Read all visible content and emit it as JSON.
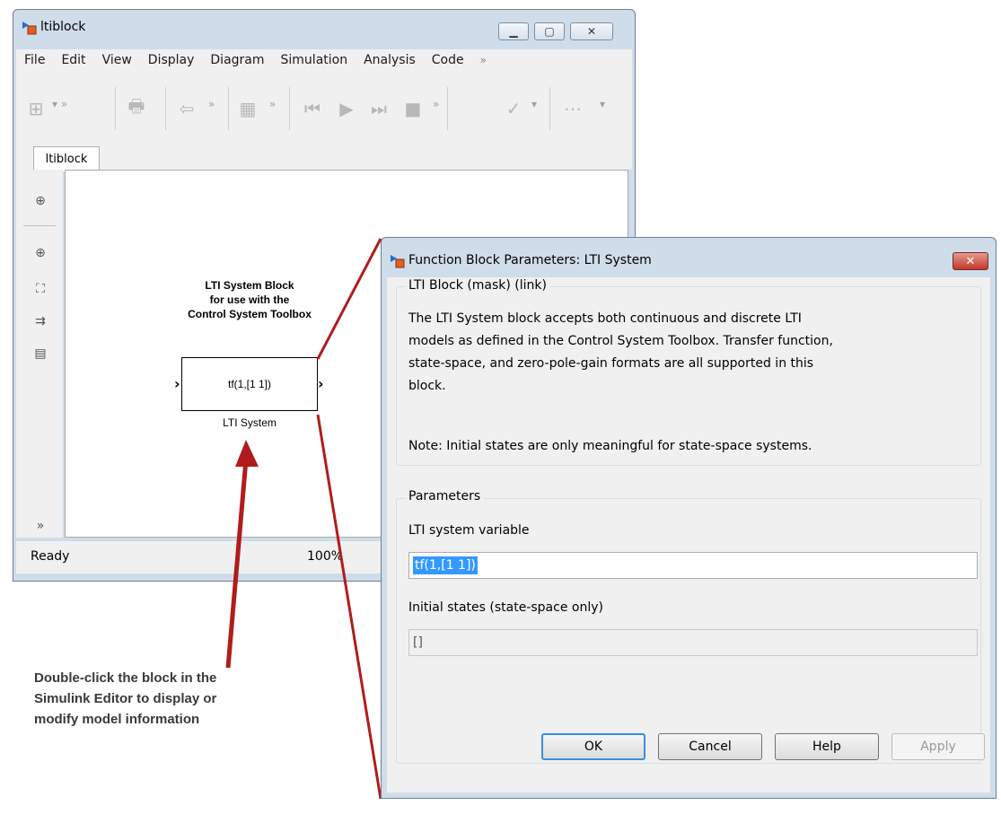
{
  "editor": {
    "title": "ltiblock",
    "menu": [
      "File",
      "Edit",
      "View",
      "Display",
      "Diagram",
      "Simulation",
      "Analysis",
      "Code"
    ],
    "menu_more": "»",
    "tab_label": "ltiblock",
    "status_left": "Ready",
    "zoom": "100%"
  },
  "block": {
    "caption_line1": "LTI System Block",
    "caption_line2": "for use with the",
    "caption_line3": "Control System Toolbox",
    "expression": "tf(1,[1 1])",
    "name": "LTI System"
  },
  "annotation": {
    "line1": "Double-click the block in the",
    "line2": "Simulink Editor to display or",
    "line3": "modify model information"
  },
  "dialog": {
    "title": "Function Block Parameters: LTI System",
    "mask_group": "LTI Block (mask) (link)",
    "description_lines": [
      "The LTI System block accepts both continuous and discrete LTI",
      "models as defined in the Control System Toolbox. Transfer function,",
      "state-space, and zero-pole-gain formats are all supported in this",
      "block."
    ],
    "note": "Note: Initial states are only meaningful for state-space systems.",
    "params_group": "Parameters",
    "lti_var_label": "LTI system variable",
    "lti_var_value": "tf(1,[1 1])",
    "init_label": "Initial states (state-space only)",
    "init_value": "[]",
    "buttons": {
      "ok": "OK",
      "cancel": "Cancel",
      "help": "Help",
      "apply": "Apply"
    }
  },
  "colors": {
    "arrow": "#b01c1c",
    "selection": "#3399ff",
    "chrome": "#cfdcea"
  }
}
